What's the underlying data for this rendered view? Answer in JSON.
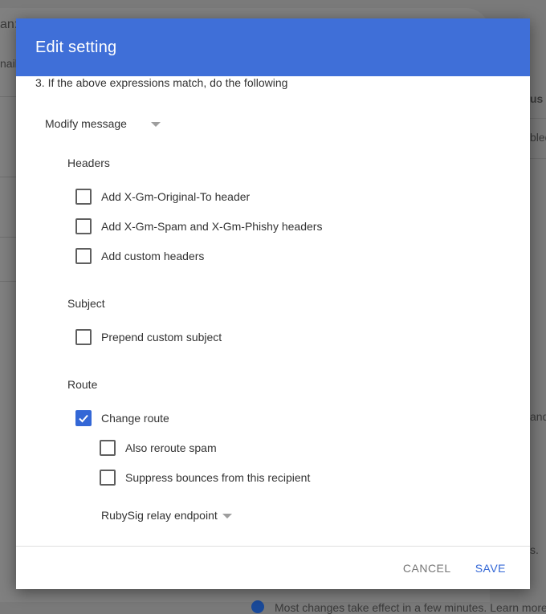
{
  "background": {
    "fragments": [
      "an:",
      "nail",
      "us",
      "bled",
      "and",
      "s.",
      "Most changes take effect in a few minutes. Learn more"
    ]
  },
  "dialog": {
    "title": "Edit setting",
    "step_text": "3. If the above expressions match, do the following",
    "action_dropdown": {
      "value": "Modify message"
    },
    "sections": {
      "headers": {
        "label": "Headers",
        "options": [
          {
            "label": "Add X-Gm-Original-To header",
            "checked": false
          },
          {
            "label": "Add X-Gm-Spam and X-Gm-Phishy headers",
            "checked": false
          },
          {
            "label": "Add custom headers",
            "checked": false
          }
        ]
      },
      "subject": {
        "label": "Subject",
        "options": [
          {
            "label": "Prepend custom subject",
            "checked": false
          }
        ]
      },
      "route": {
        "label": "Route",
        "change_route": {
          "label": "Change route",
          "checked": true
        },
        "sub_options": [
          {
            "label": "Also reroute spam",
            "checked": false
          },
          {
            "label": "Suppress bounces from this recipient",
            "checked": false
          }
        ],
        "route_dropdown": {
          "value": "RubySig relay endpoint"
        }
      }
    },
    "footer": {
      "cancel_label": "CANCEL",
      "save_label": "SAVE"
    }
  },
  "colors": {
    "header": "#3f6fd8",
    "accent": "#3367d6"
  }
}
